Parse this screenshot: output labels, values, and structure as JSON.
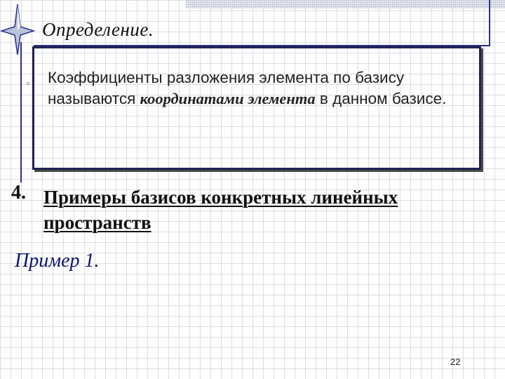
{
  "slide": {
    "definition_title": "Определение.",
    "definition": {
      "text_1": "Коэффициенты разложения элемента по базису называются ",
      "term": "координатами элемента",
      "text_2": " в данном базисе."
    },
    "section_number": "4.",
    "section_heading": "Примеры базисов конкретных линейных пространств",
    "example_label": "Пример 1.",
    "page_number": "22"
  }
}
